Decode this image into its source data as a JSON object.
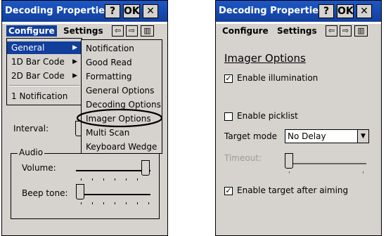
{
  "left": {
    "title": "Decoding Properties",
    "help": "?",
    "ok": "OK",
    "close": "✕",
    "menubar": {
      "configure": "Configure",
      "settings": "Settings"
    },
    "nav_left": "⇦",
    "nav_right": "⇨",
    "keyboard": "▥",
    "configure_menu": [
      {
        "label": "General",
        "arrow": "▶"
      },
      {
        "label": "1D Bar Code",
        "arrow": "▶"
      },
      {
        "label": "2D Bar Code",
        "arrow": "▶"
      },
      {
        "label": "1 Notification"
      }
    ],
    "submenu": [
      "Notification",
      "Good Read",
      "Formatting",
      "General Options",
      "Decoding Options",
      "Imager Options",
      "Multi Scan",
      "Keyboard Wedge"
    ],
    "interval_label": "Interval:",
    "audio_group": "Audio",
    "volume_label": "Volume:",
    "beep_label": "Beep tone:"
  },
  "right": {
    "title": "Decoding Properties",
    "help": "?",
    "ok": "OK",
    "close": "✕",
    "menubar": {
      "configure": "Configure",
      "settings": "Settings"
    },
    "nav_left": "⇦",
    "nav_right": "⇨",
    "keyboard": "▥",
    "heading": "Imager Options",
    "enable_illumination": {
      "label": "Enable illumination",
      "checked": true,
      "mark": "✓"
    },
    "enable_picklist": {
      "label": "Enable picklist",
      "checked": false,
      "mark": ""
    },
    "target_mode_label": "Target mode",
    "target_mode_value": "No Delay",
    "combo_arrow": "▼",
    "timeout_label": "Timeout:",
    "enable_target": {
      "label": "Enable target after aiming",
      "checked": true,
      "mark": "✓"
    }
  }
}
